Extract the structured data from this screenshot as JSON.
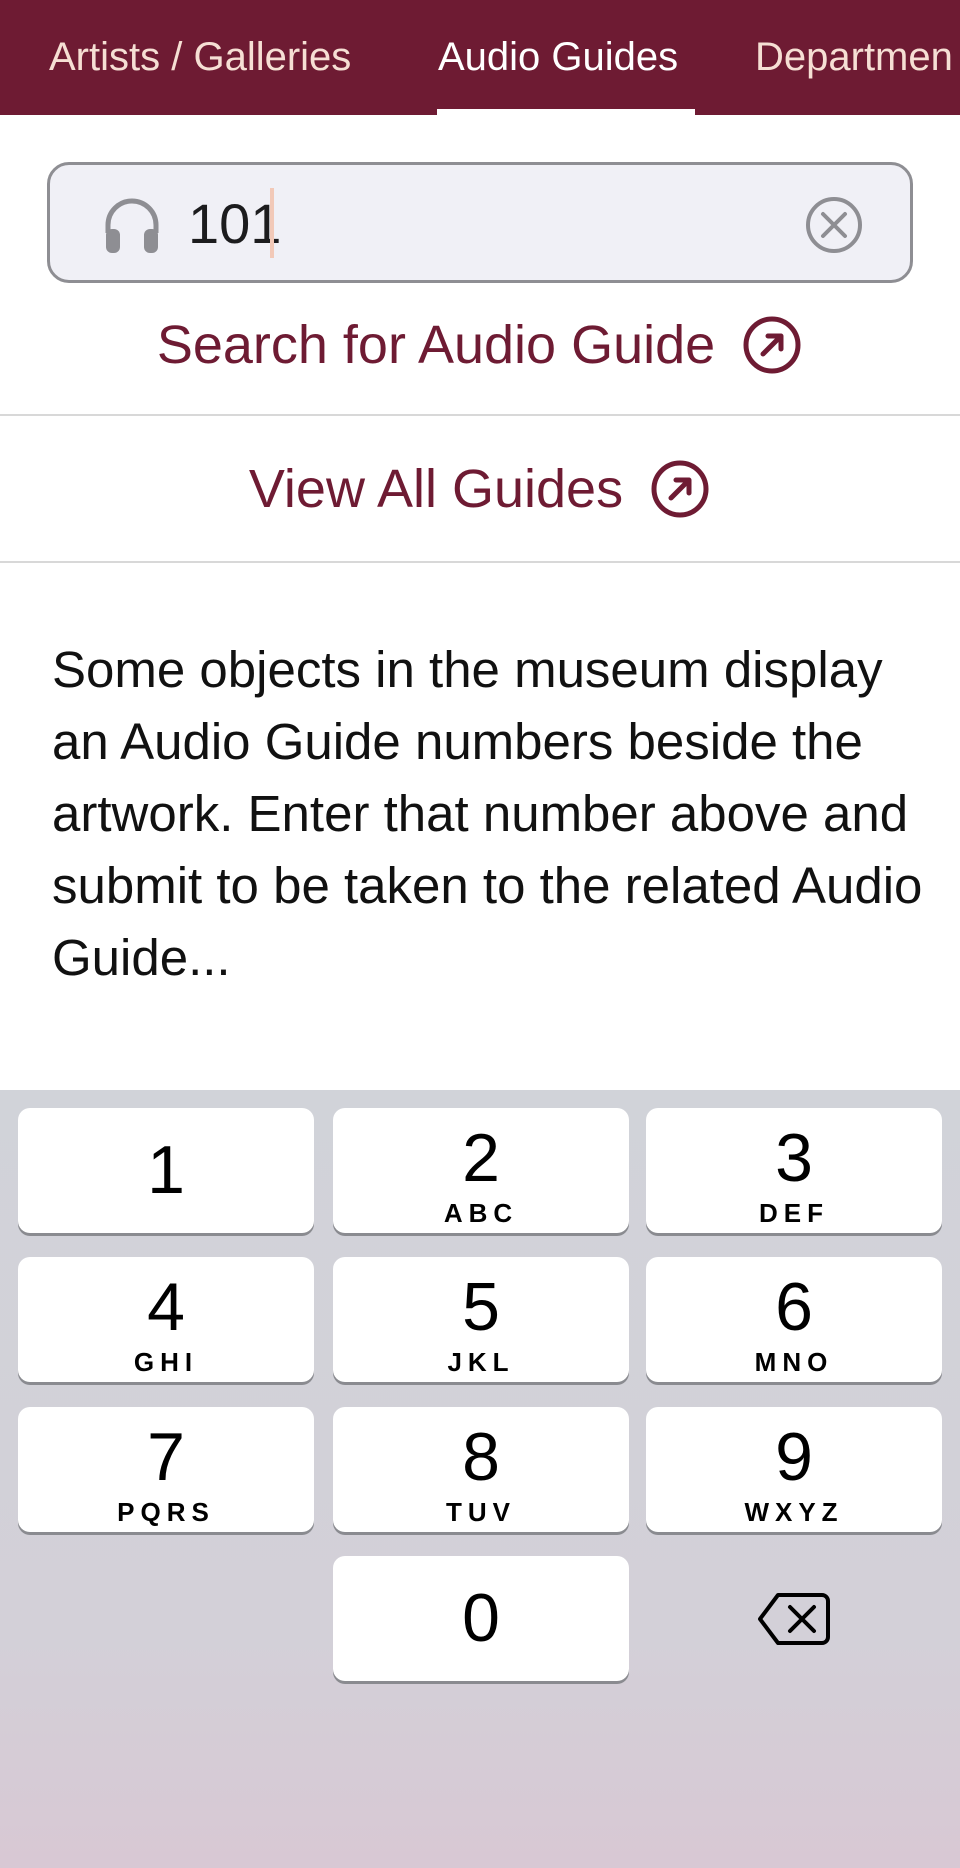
{
  "tabs": [
    {
      "label": "Artists / Galleries"
    },
    {
      "label": "Audio Guides"
    },
    {
      "label": "Departmen"
    }
  ],
  "search": {
    "value": "101",
    "icon": "headphones-icon",
    "clear_icon": "clear-icon"
  },
  "links": {
    "search_label": "Search for Audio Guide",
    "view_all_label": "View All Guides"
  },
  "description": "Some objects in the museum display an Audio Guide numbers beside the artwork. Enter that number above and submit to be taken to the related Audio Guide...",
  "keypad": {
    "keys": [
      {
        "digit": "1",
        "letters": ""
      },
      {
        "digit": "2",
        "letters": "ABC"
      },
      {
        "digit": "3",
        "letters": "DEF"
      },
      {
        "digit": "4",
        "letters": "GHI"
      },
      {
        "digit": "5",
        "letters": "JKL"
      },
      {
        "digit": "6",
        "letters": "MNO"
      },
      {
        "digit": "7",
        "letters": "PQRS"
      },
      {
        "digit": "8",
        "letters": "TUV"
      },
      {
        "digit": "9",
        "letters": "WXYZ"
      },
      {
        "digit": "0",
        "letters": ""
      }
    ]
  },
  "colors": {
    "brand": "#6e1b33",
    "tab_text": "#f6dfd4"
  }
}
